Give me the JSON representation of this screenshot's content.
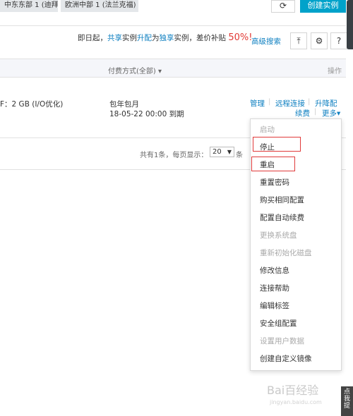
{
  "header": {
    "region_tabs": [
      "中东东部 1 (迪拜)",
      "欧洲中部 1 (法兰克福)"
    ],
    "refresh_icon": "refresh-icon",
    "create_button": "创建实例"
  },
  "promo": {
    "prefix": "即日起，",
    "shared": "共享",
    "text1": "实例",
    "upgrade": "升配",
    "text2": "为",
    "exclusive": "独享",
    "text3": "实例，差价补贴 ",
    "percent": "50%!"
  },
  "toolbar": {
    "advanced_search": "高级搜索",
    "export_icon": "export-icon",
    "settings_icon": "gear-icon",
    "help_label": "?"
  },
  "table": {
    "headers": {
      "payment": "付费方式(全部)",
      "operations": "操作"
    },
    "row": {
      "spec": "F：2 GB (I/O优化)",
      "billing": "包年包月",
      "expire": "18-05-22 00:00 到期",
      "ops": {
        "manage": "管理",
        "remote": "远程连接",
        "upgrade": "升降配",
        "renew": "续费",
        "more": "更多"
      }
    },
    "separator": "|"
  },
  "pager": {
    "prefix": "共有1条，每页显示：",
    "page_size": "20",
    "suffix": "条"
  },
  "dropdown": {
    "items": [
      {
        "label": "启动",
        "disabled": true
      },
      {
        "label": "停止",
        "disabled": false
      },
      {
        "label": "重启",
        "disabled": false
      },
      {
        "label": "重置密码",
        "disabled": false
      },
      {
        "label": "购买相同配置",
        "disabled": false
      },
      {
        "label": "配置自动续费",
        "disabled": false
      },
      {
        "label": "更换系统盘",
        "disabled": true
      },
      {
        "label": "重新初始化磁盘",
        "disabled": true
      },
      {
        "label": "修改信息",
        "disabled": false
      },
      {
        "label": "连接帮助",
        "disabled": false
      },
      {
        "label": "编辑标签",
        "disabled": false
      },
      {
        "label": "安全组配置",
        "disabled": false
      },
      {
        "label": "设置用户数据",
        "disabled": true
      },
      {
        "label": "创建自定义镜像",
        "disabled": false
      }
    ]
  },
  "side": {
    "feedback": "点我提"
  },
  "watermark": {
    "text": "Bai百经验",
    "url": "jingyan.baidu.com"
  },
  "colors": {
    "accent": "#00a2ca",
    "link": "#0d7fc0",
    "highlight": "#e03a3a",
    "promo_red": "#e23a36"
  }
}
